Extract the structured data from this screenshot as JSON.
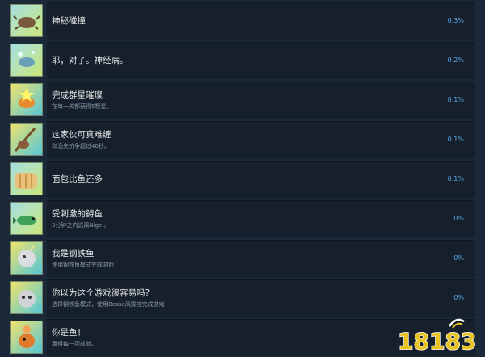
{
  "achievements": [
    {
      "title": "神秘碰撞",
      "desc": "",
      "percent": "0.3%",
      "icon": "crab-icon"
    },
    {
      "title": "耶，对了。神经病。",
      "desc": "",
      "percent": "0.2%",
      "icon": "splash-fish-icon"
    },
    {
      "title": "完成群星璀璨",
      "desc": "在每一关都获得5颗星。",
      "percent": "0.1%",
      "icon": "star-fish-icon"
    },
    {
      "title": "这家伙可真难缠",
      "desc": "和渔夫抗争超过40秒。",
      "percent": "0.1%",
      "icon": "fishing-rod-icon"
    },
    {
      "title": "面包比鱼还多",
      "desc": "",
      "percent": "0.1%",
      "icon": "bread-icon"
    },
    {
      "title": "受刺激的鲟鱼",
      "desc": "3分钟之内逃离Nigel。",
      "percent": "0%",
      "icon": "green-fish-icon"
    },
    {
      "title": "我是钢铁鱼",
      "desc": "使用钢铁鱼模式完成游戏",
      "percent": "0%",
      "icon": "iron-fish-icon"
    },
    {
      "title": "你以为这个游戏很容易吗?",
      "desc": "选择钢铁鱼模式，使用Bossa风操控完成游戏",
      "percent": "0%",
      "icon": "iron-fish-boss-icon"
    },
    {
      "title": "你是鱼！",
      "desc": "赢得每一项成就。",
      "percent": "",
      "icon": "orange-fish-icon"
    }
  ],
  "watermark": {
    "text": "18183",
    "color": "#e8c21f"
  }
}
